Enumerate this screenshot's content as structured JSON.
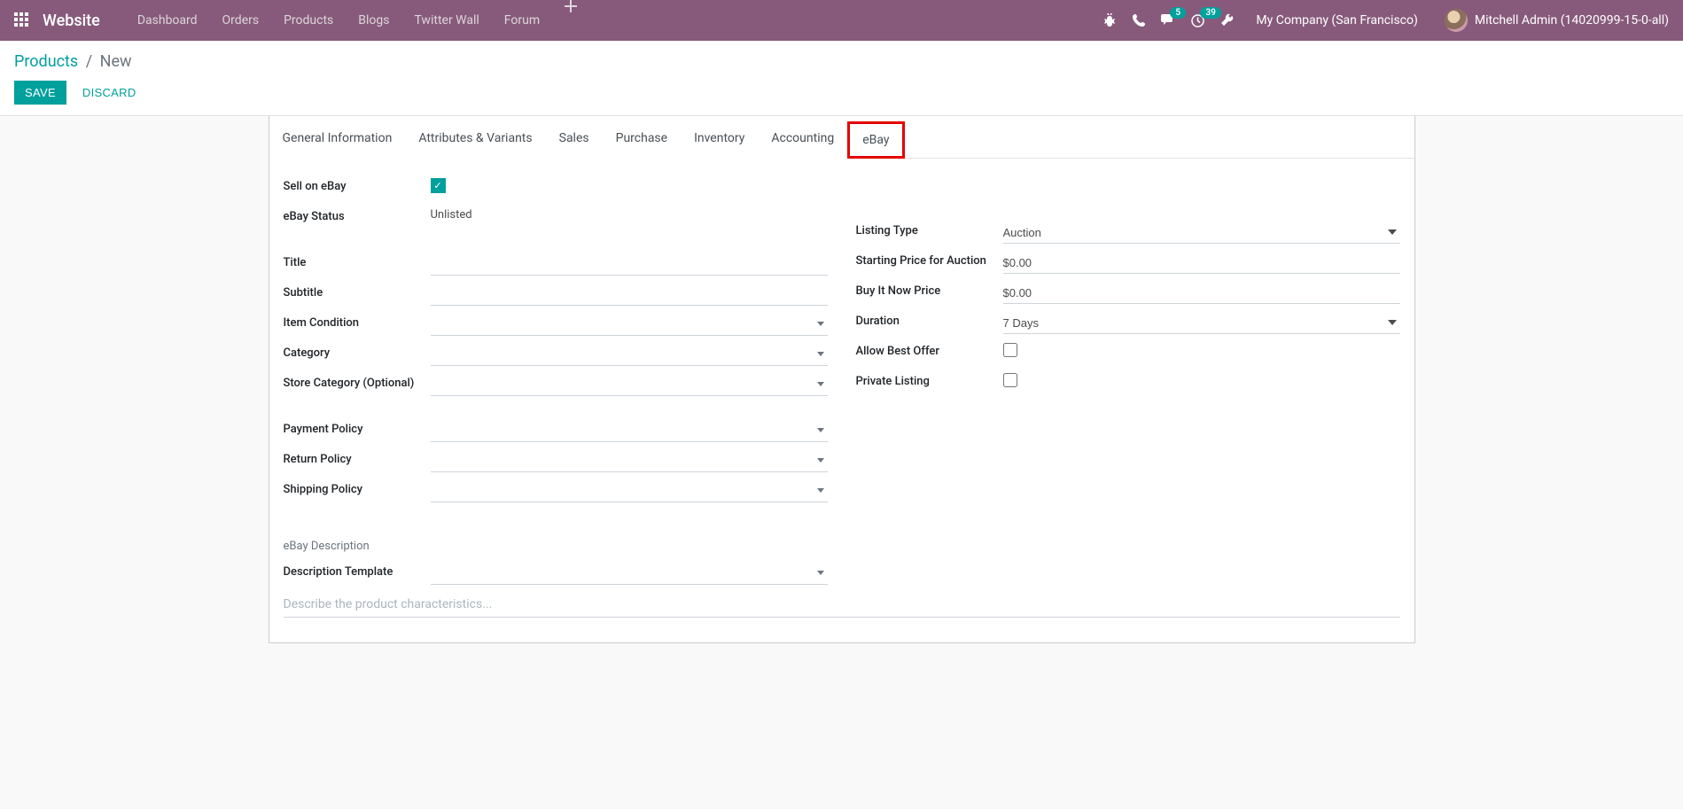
{
  "header": {
    "brand": "Website",
    "nav": [
      "Dashboard",
      "Orders",
      "Products",
      "Blogs",
      "Twitter Wall",
      "Forum"
    ],
    "messages_badge": "5",
    "activities_badge": "39",
    "company": "My Company (San Francisco)",
    "user": "Mitchell Admin (14020999-15-0-all)"
  },
  "breadcrumb": {
    "parent": "Products",
    "current": "New"
  },
  "buttons": {
    "save": "SAVE",
    "discard": "DISCARD"
  },
  "tabs": [
    "General Information",
    "Attributes & Variants",
    "Sales",
    "Purchase",
    "Inventory",
    "Accounting",
    "eBay"
  ],
  "form": {
    "left": {
      "sell_on_ebay_label": "Sell on eBay",
      "ebay_status_label": "eBay Status",
      "ebay_status_value": "Unlisted",
      "title_label": "Title",
      "title_value": "",
      "subtitle_label": "Subtitle",
      "subtitle_value": "",
      "item_condition_label": "Item Condition",
      "item_condition_value": "",
      "category_label": "Category",
      "category_value": "",
      "store_category_label": "Store Category (Optional)",
      "store_category_value": "",
      "payment_policy_label": "Payment Policy",
      "payment_policy_value": "",
      "return_policy_label": "Return Policy",
      "return_policy_value": "",
      "shipping_policy_label": "Shipping Policy",
      "shipping_policy_value": ""
    },
    "right": {
      "listing_type_label": "Listing Type",
      "listing_type_value": "Auction",
      "starting_price_label": "Starting Price for Auction",
      "starting_price_value": "$0.00",
      "buy_it_now_label": "Buy It Now Price",
      "buy_it_now_value": "$0.00",
      "duration_label": "Duration",
      "duration_value": "7 Days",
      "allow_best_offer_label": "Allow Best Offer",
      "private_listing_label": "Private Listing"
    },
    "desc": {
      "section_title": "eBay Description",
      "template_label": "Description Template",
      "template_value": "",
      "placeholder": "Describe the product characteristics..."
    }
  }
}
